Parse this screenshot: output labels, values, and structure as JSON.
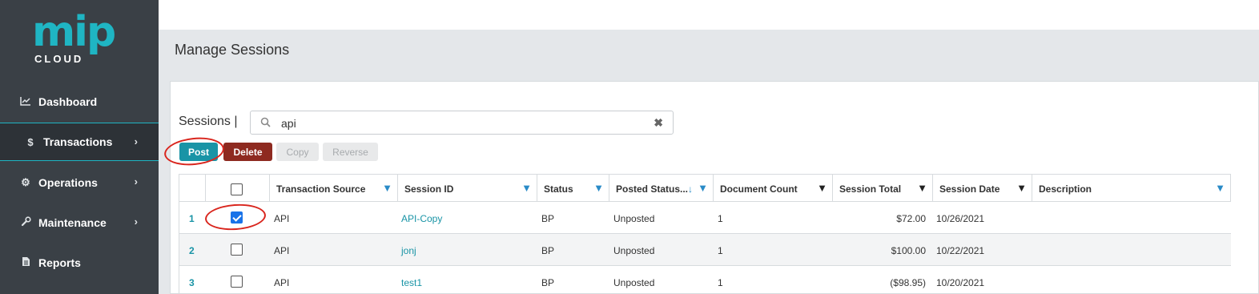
{
  "logo": {
    "main": "mip",
    "sub": "CLOUD",
    "reg": "®"
  },
  "nav": [
    {
      "label": "Dashboard",
      "icon": "chart-line-icon",
      "glyph": "📈"
    },
    {
      "label": "Transactions",
      "icon": "dollar-icon",
      "glyph": "$"
    },
    {
      "label": "Operations",
      "icon": "gears-icon",
      "glyph": "⚙"
    },
    {
      "label": "Maintenance",
      "icon": "wrench-icon",
      "glyph": "🔧"
    },
    {
      "label": "Reports",
      "icon": "document-icon",
      "glyph": "📄"
    }
  ],
  "page": {
    "title": "Manage Sessions"
  },
  "sessions": {
    "label": "Sessions |",
    "search_value": "api",
    "search_glyph": "🔍",
    "clear_glyph": "✖"
  },
  "toolbar": {
    "post": "Post",
    "delete": "Delete",
    "copy": "Copy",
    "reverse": "Reverse"
  },
  "grid": {
    "columns": [
      {
        "label": "Transaction Source",
        "filter": "blue"
      },
      {
        "label": "Session ID",
        "filter": "blue"
      },
      {
        "label": "Status",
        "filter": "blue"
      },
      {
        "label": "Posted Status...",
        "sort": "↓",
        "filter": "blue"
      },
      {
        "label": "Document Count",
        "filter": "dark"
      },
      {
        "label": "Session Total",
        "filter": "dark"
      },
      {
        "label": "Session Date",
        "filter": "dark"
      },
      {
        "label": "Description",
        "filter": "blue"
      }
    ],
    "filter_glyph": "▼",
    "rows": [
      {
        "num": "1",
        "checked": true,
        "source": "API",
        "session_id": "API-Copy",
        "status": "BP",
        "posted": "Unposted",
        "doc_count": "1",
        "total": "$72.00",
        "date": "10/26/2021",
        "description": ""
      },
      {
        "num": "2",
        "checked": false,
        "source": "API",
        "session_id": "jonj",
        "status": "BP",
        "posted": "Unposted",
        "doc_count": "1",
        "total": "$100.00",
        "date": "10/22/2021",
        "description": ""
      },
      {
        "num": "3",
        "checked": false,
        "source": "API",
        "session_id": "test1",
        "status": "BP",
        "posted": "Unposted",
        "doc_count": "1",
        "total": "($98.95)",
        "date": "10/20/2021",
        "description": ""
      }
    ]
  },
  "colors": {
    "accent": "#1fb5c3",
    "link": "#1994a6",
    "danger": "#8e2a20",
    "annotation": "#d9251d",
    "sidebar": "#3a4046"
  }
}
